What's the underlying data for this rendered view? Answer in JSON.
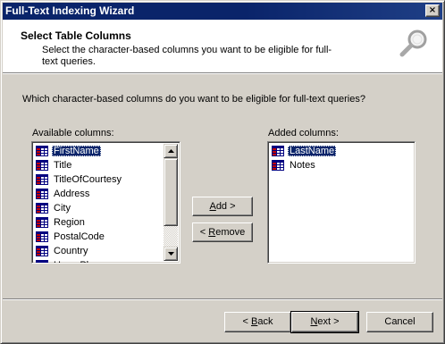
{
  "window": {
    "title": "Full-Text Indexing Wizard",
    "close_glyph": "×"
  },
  "header": {
    "title": "Select Table Columns",
    "description": "Select the character-based columns you want to be eligible for full-text queries.",
    "icon": "magnifier-icon"
  },
  "main": {
    "question": "Which character-based columns do you want to be eligible for full-text queries?",
    "available_label": "Available columns:",
    "added_label": "Added columns:",
    "available_columns": [
      {
        "label": "FirstName",
        "selected": true
      },
      {
        "label": "Title",
        "selected": false
      },
      {
        "label": "TitleOfCourtesy",
        "selected": false
      },
      {
        "label": "Address",
        "selected": false
      },
      {
        "label": "City",
        "selected": false
      },
      {
        "label": "Region",
        "selected": false
      },
      {
        "label": "PostalCode",
        "selected": false
      },
      {
        "label": "Country",
        "selected": false
      },
      {
        "label": "HomePhone",
        "selected": false
      }
    ],
    "added_columns": [
      {
        "label": "LastName",
        "selected": true
      },
      {
        "label": "Notes",
        "selected": false
      }
    ],
    "add_button": {
      "pre": "",
      "key": "A",
      "post": "dd >"
    },
    "remove_button": {
      "pre": "< ",
      "key": "R",
      "post": "emove"
    }
  },
  "footer": {
    "back_button": {
      "pre": "< ",
      "key": "B",
      "post": "ack"
    },
    "next_button": {
      "pre": "",
      "key": "N",
      "post": "ext >"
    },
    "cancel_button": {
      "label": "Cancel"
    }
  },
  "colors": {
    "selection": "#0a246a",
    "face": "#d4d0c8",
    "title_bar": "#0a246a"
  }
}
